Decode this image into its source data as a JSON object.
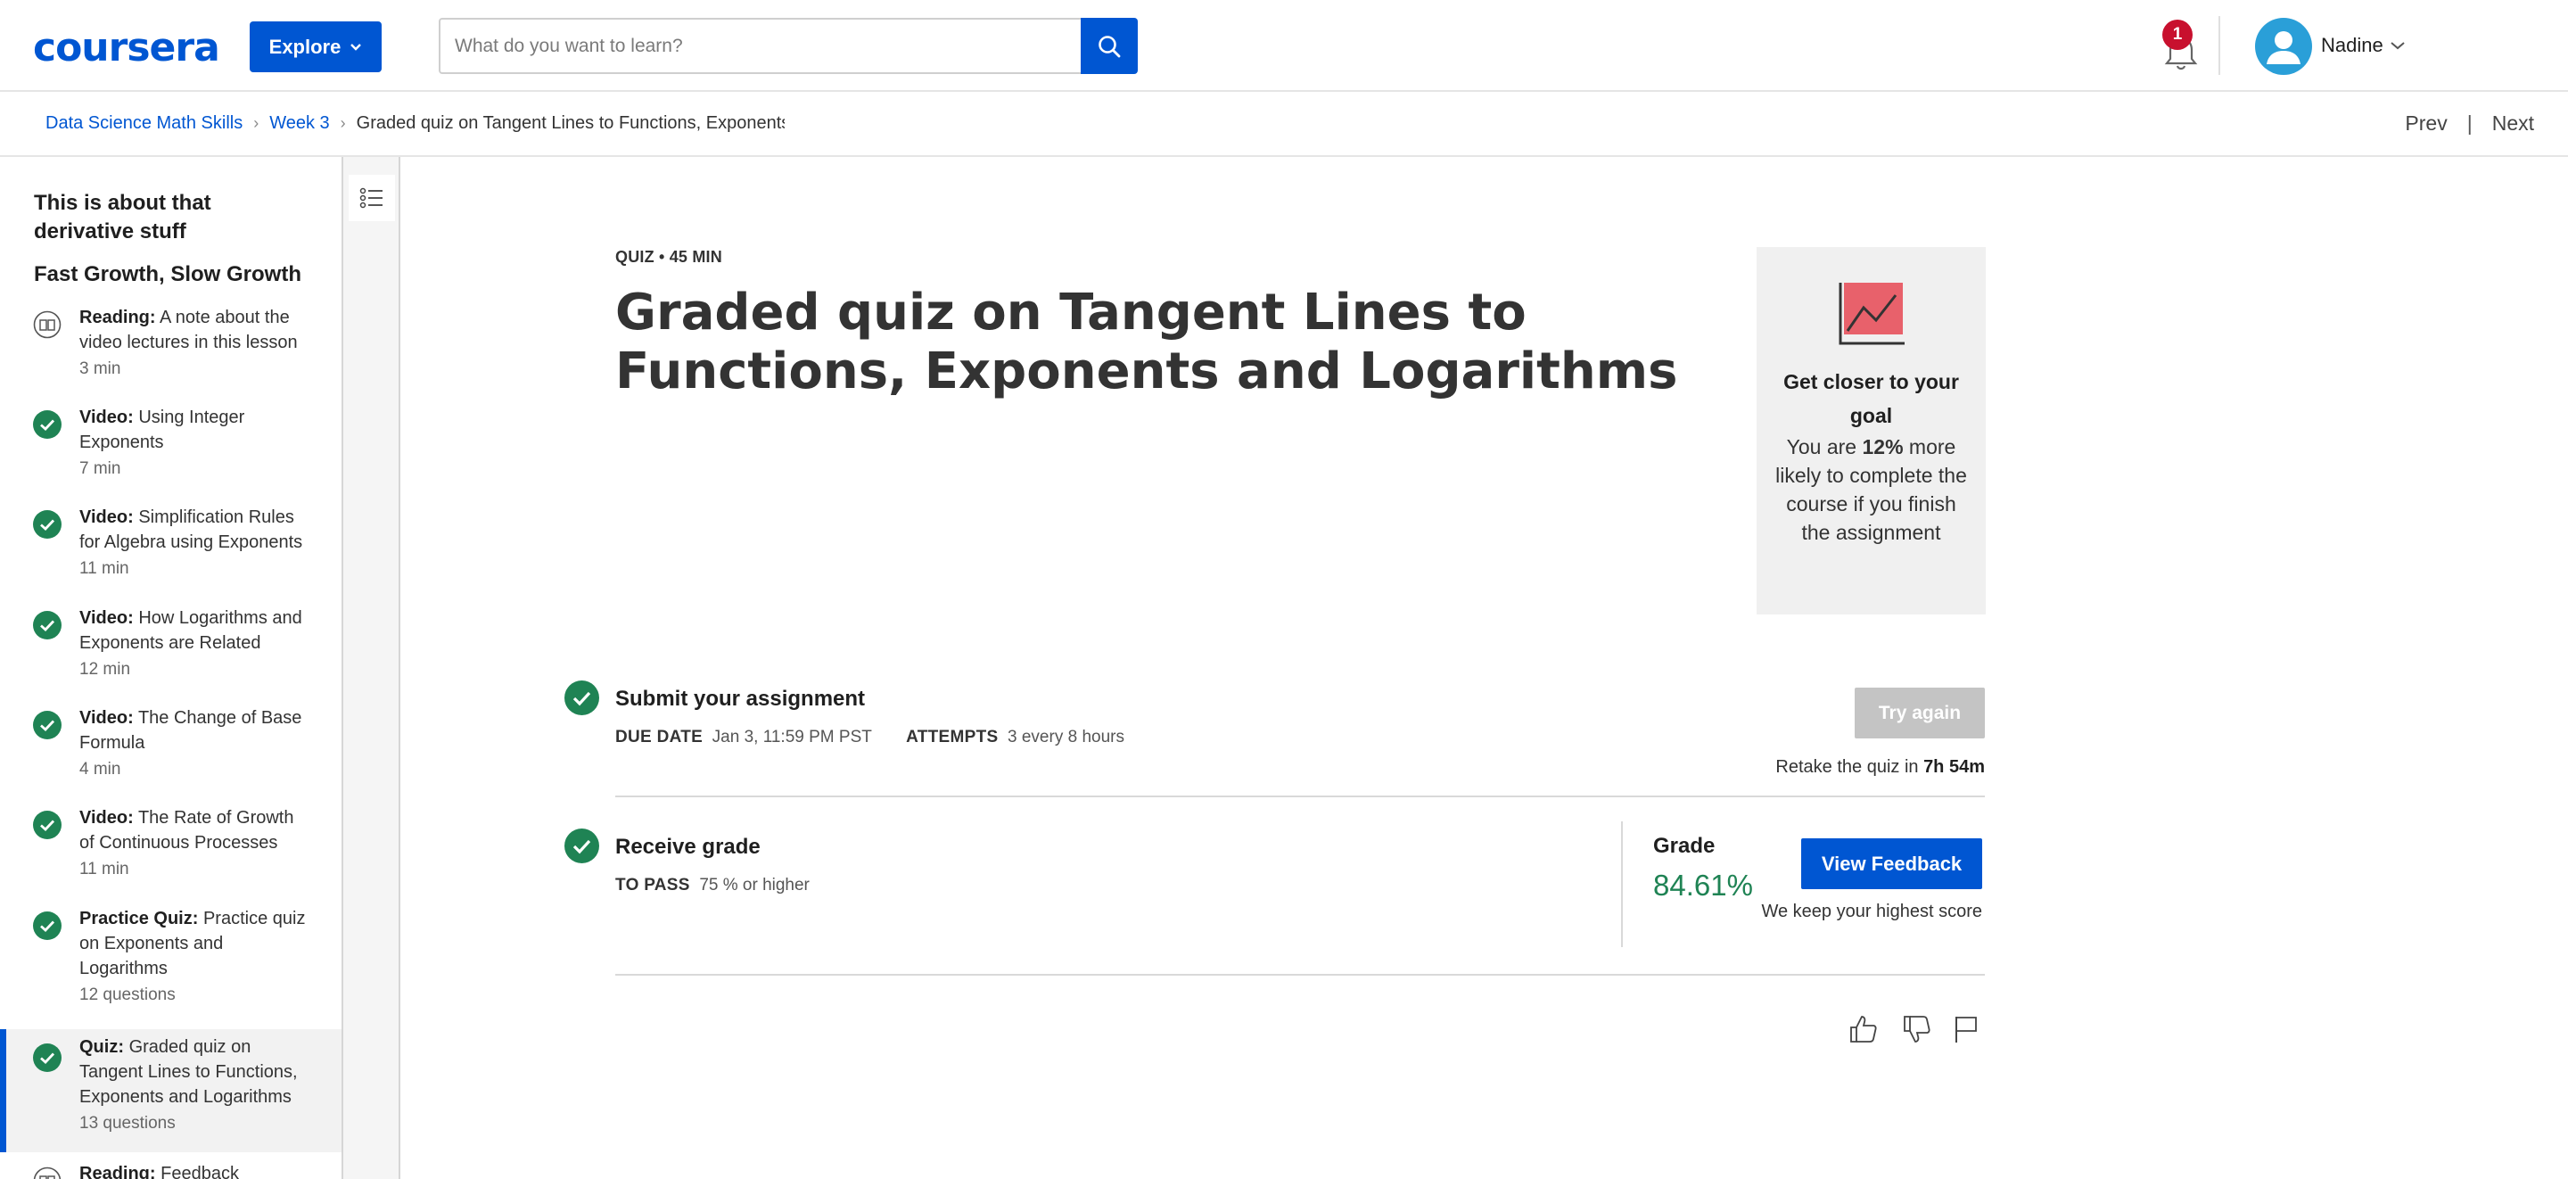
{
  "header": {
    "logo": "coursera",
    "explore_label": "Explore",
    "search_placeholder": "What do you want to learn?",
    "notification_count": "1",
    "user_name": "Nadine"
  },
  "breadcrumb": {
    "items": [
      "Data Science Math Skills",
      "Week 3"
    ],
    "current": "Graded quiz on Tangent Lines to Functions, Exponents and Logarithms",
    "prev": "Prev",
    "next": "Next"
  },
  "sidebar": {
    "lesson_title": "This is about that derivative stuff",
    "section_title": "Fast Growth, Slow Growth",
    "items": [
      {
        "type": "Reading:",
        "title": "A note about the video lectures in this lesson",
        "meta": "3 min",
        "icon": "reading-icon"
      },
      {
        "type": "Video:",
        "title": "Using Integer Exponents",
        "meta": "7 min",
        "icon": "check-icon"
      },
      {
        "type": "Video:",
        "title": "Simplification Rules for Algebra using Exponents",
        "meta": "11 min",
        "icon": "check-icon"
      },
      {
        "type": "Video:",
        "title": "How Logarithms and Exponents are Related",
        "meta": "12 min",
        "icon": "check-icon"
      },
      {
        "type": "Video:",
        "title": "The Change of Base Formula",
        "meta": "4 min",
        "icon": "check-icon"
      },
      {
        "type": "Video:",
        "title": "The Rate of Growth of Continuous Processes",
        "meta": "11 min",
        "icon": "check-icon"
      },
      {
        "type": "Practice Quiz:",
        "title": "Practice quiz on Exponents and Logarithms",
        "meta": "12 questions",
        "icon": "check-icon"
      },
      {
        "type": "Quiz:",
        "title": "Graded quiz on Tangent Lines to Functions, Exponents and Logarithms",
        "meta": "13 questions",
        "icon": "check-icon",
        "active": true
      },
      {
        "type": "Reading:",
        "title": "Feedback",
        "meta": "",
        "icon": "reading-icon"
      }
    ]
  },
  "main": {
    "eyebrow": "QUIZ • 45 MIN",
    "title": "Graded quiz on Tangent Lines to Functions, Exponents and Logarithms",
    "goal_card": {
      "title": "Get closer to your goal",
      "body_prefix": "You are ",
      "body_percent": "12%",
      "body_suffix": " more likely to complete the course if you finish the assignment"
    },
    "submit": {
      "title": "Submit your assignment",
      "due_label": "DUE DATE",
      "due_value": "Jan 3, 11:59 PM PST",
      "attempts_label": "ATTEMPTS",
      "attempts_value": "3 every 8 hours",
      "try_again": "Try again",
      "retake_prefix": "Retake the quiz in ",
      "retake_time": "7h 54m"
    },
    "grade": {
      "title": "Receive grade",
      "pass_label": "TO PASS",
      "pass_value": "75 % or higher",
      "grade_label": "Grade",
      "grade_value": "84.61%",
      "feedback_button": "View Feedback",
      "keep_note": "We keep your highest score"
    }
  },
  "colors": {
    "brand": "#0056d2",
    "success": "#1f8354",
    "badge": "#c8102e",
    "disabled": "#c4c4c4"
  }
}
